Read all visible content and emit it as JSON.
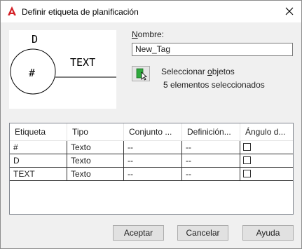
{
  "window": {
    "title": "Definir etiqueta de planificación"
  },
  "preview": {
    "top_label": "D",
    "center_label": "#",
    "side_label": "TEXT"
  },
  "name_field": {
    "label_underlined": "N",
    "label_rest": "ombre:",
    "value": "New_Tag"
  },
  "select_objects": {
    "label_pre": "Seleccionar ",
    "label_underlined": "o",
    "label_post": "bjetos",
    "count_text": "5 elementos seleccionados"
  },
  "table": {
    "columns": [
      "Etiqueta",
      "Tipo",
      "Conjunto ...",
      "Definición...",
      "Ángulo d..."
    ],
    "rows": [
      {
        "etiqueta": "#",
        "tipo": "Texto",
        "conjunto": "--",
        "definicion": "--",
        "angulo": false
      },
      {
        "etiqueta": "D",
        "tipo": "Texto",
        "conjunto": "--",
        "definicion": "--",
        "angulo": false
      },
      {
        "etiqueta": "TEXT",
        "tipo": "Texto",
        "conjunto": "--",
        "definicion": "--",
        "angulo": false
      }
    ]
  },
  "buttons": {
    "accept": "Aceptar",
    "cancel": "Cancelar",
    "help": "Ayuda"
  },
  "colors": {
    "app_icon_red": "#d42127",
    "select_button_green": "#2eaa3c"
  }
}
